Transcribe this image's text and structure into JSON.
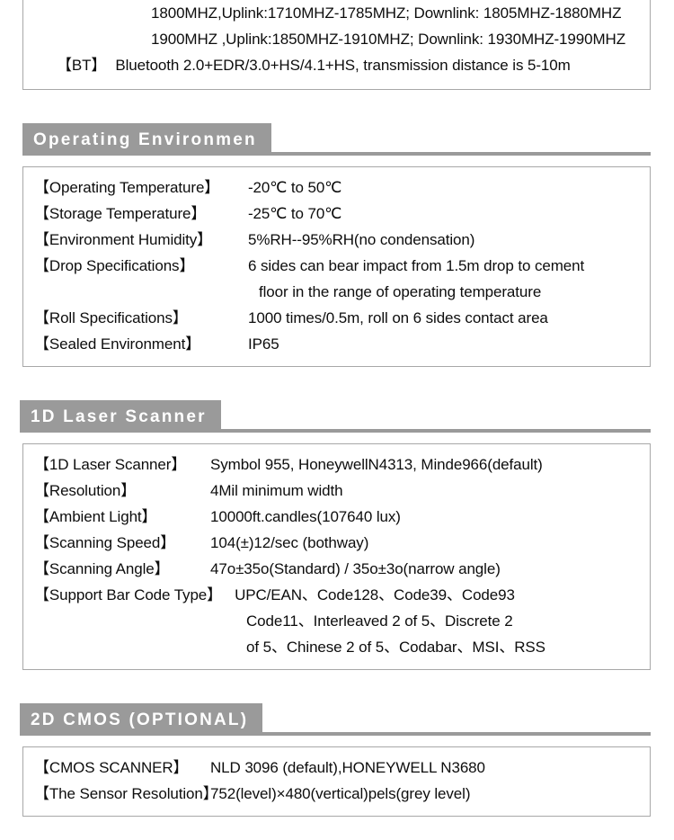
{
  "document": {
    "type": "product-specification-sheet",
    "header_bg": "#9a9a9a",
    "header_text_color": "#ffffff",
    "box_border_color": "#a8a8a8"
  },
  "top_box": {
    "lines": [
      {
        "indent": "value-only",
        "text": "1800MHZ,Uplink:1710MHZ-1785MHZ;  Downlink: 1805MHZ-1880MHZ"
      },
      {
        "indent": "value-only",
        "text": "1900MHZ ,Uplink:1850MHZ-1910MHZ;  Downlink: 1930MHZ-1990MHZ"
      }
    ],
    "bt_row": {
      "label": "【BT】",
      "value": "Bluetooth 2.0+EDR/3.0+HS/4.1+HS, transmission distance is 5-10m"
    }
  },
  "sections": [
    {
      "id": "operating-environment",
      "title": "Operating Environmen",
      "rows": [
        {
          "label": "【Operating Temperature】",
          "value": "-20℃ to 50℃"
        },
        {
          "label": "【Storage Temperature】",
          "value": "-25℃ to 70℃"
        },
        {
          "label": "【Environment Humidity】",
          "value": "5%RH--95%RH(no condensation)"
        },
        {
          "label": "【Drop Specifications】",
          "value": "6 sides can bear impact from 1.5m drop to cement"
        },
        {
          "label": "",
          "value": "floor in the range of operating temperature",
          "continuation": true
        },
        {
          "label": "【Roll Specifications】",
          "value": "1000 times/0.5m, roll on 6 sides contact area"
        },
        {
          "label": "【Sealed Environment】",
          "value": "IP65"
        }
      ]
    },
    {
      "id": "1d-laser-scanner",
      "title": "1D Laser Scanner",
      "rows": [
        {
          "label": "【1D Laser Scanner】",
          "value": "Symbol 955, HoneywellN4313, Minde966(default)"
        },
        {
          "label": "【Resolution】",
          "value": "4Mil minimum width"
        },
        {
          "label": "【Ambient Light】",
          "value": "10000ft.candles(107640 lux)"
        },
        {
          "label": "【Scanning Speed】",
          "value": "104(±)12/sec (bothway)"
        },
        {
          "label": "【Scanning Angle】",
          "value": "47o±35o(Standard) / 35o±3o(narrow angle)"
        },
        {
          "label": "【Support Bar Code Type】",
          "value": "UPC/EAN、Code128、Code39、Code93"
        },
        {
          "label": "",
          "value": "Code11、Interleaved 2 of 5、Discrete 2",
          "continuation": true
        },
        {
          "label": "",
          "value": "of 5、Chinese 2 of 5、Codabar、MSI、RSS",
          "continuation": true
        }
      ]
    },
    {
      "id": "2d-cmos-optional",
      "title": "2D CMOS (OPTIONAL)",
      "rows": [
        {
          "label": "【CMOS SCANNER】",
          "value": "NLD 3096 (default),HONEYWELL N3680"
        },
        {
          "label": "【The Sensor  Resolution】",
          "value": "752(level)×480(vertical)pels(grey level)"
        }
      ]
    }
  ]
}
